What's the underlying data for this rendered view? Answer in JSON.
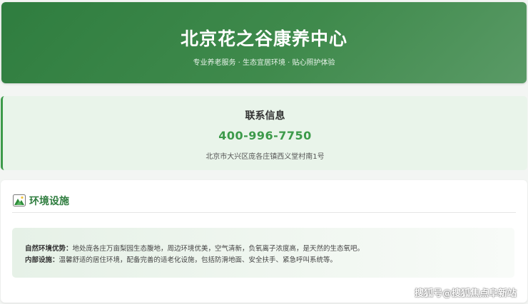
{
  "header": {
    "title": "北京花之谷康养中心",
    "subtitle": "专业养老服务 · 生态宜居环境 · 贴心照护体验"
  },
  "contact": {
    "title": "联系信息",
    "phone": "400-996-7750",
    "address": "北京市大兴区庞各庄镇西义堂村南1号"
  },
  "facilities": {
    "icon": "green-landscape-icon",
    "title": "环境设施",
    "items": [
      {
        "label": "自然环境优势：",
        "text": "地处庞各庄万亩梨园生态腹地，周边环境优美，空气清新，负氧离子浓度高，是天然的生态氧吧。"
      },
      {
        "label": "内部设施：",
        "text": "温馨舒适的居住环境，配备完善的适老化设施，包括防滑地面、安全扶手、紧急呼叫系统等。"
      }
    ]
  },
  "watermark": "搜狐号@搜狐焦点阜新站",
  "colors": {
    "brand_green": "#2f7d3f",
    "accent_green": "#3c9a4a",
    "contact_bg": "#e9f4ea"
  }
}
